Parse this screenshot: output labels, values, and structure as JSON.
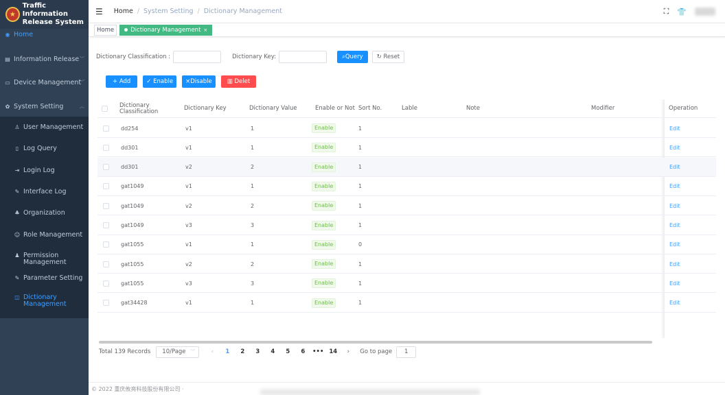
{
  "app": {
    "title_line1": "Traffic Information",
    "title_line2": "Release System"
  },
  "sidebar": {
    "items": [
      {
        "label": "Home",
        "icon": "dashboard-icon"
      },
      {
        "label": "Information Release",
        "icon": "message-icon"
      },
      {
        "label": "Device Management",
        "icon": "monitor-icon"
      },
      {
        "label": "System Setting",
        "icon": "gear-icon"
      }
    ],
    "subitems": [
      {
        "label": "User Management",
        "icon": "user-icon"
      },
      {
        "label": "Log Query",
        "icon": "log-icon"
      },
      {
        "label": "Login Log",
        "icon": "login-icon"
      },
      {
        "label": "Interface Log",
        "icon": "edit-icon"
      },
      {
        "label": "Organization",
        "icon": "tree-icon"
      },
      {
        "label": "Role Management",
        "icon": "people-icon"
      },
      {
        "label": "Permission Management",
        "icon": "peoples-icon"
      },
      {
        "label": "Parameter Setting",
        "icon": "tool-icon"
      },
      {
        "label": "Dictionary Management",
        "icon": "dict-icon"
      }
    ]
  },
  "header": {
    "breadcrumb": [
      "Home",
      "System Setting",
      "Dictionary Management"
    ]
  },
  "tags": {
    "home": "Home",
    "active": "Dictionary Management"
  },
  "filters": {
    "classification_label": "Dictionary Classification :",
    "classification_value": "",
    "key_label": "Dictionary Key:",
    "key_value": "",
    "query": "Query",
    "reset": "Reset"
  },
  "toolbar": {
    "add": "Add",
    "enable": "Enable",
    "disable": "Disable",
    "delete": "Delet"
  },
  "table": {
    "columns": [
      "Dictionary Classification",
      "Dictionary Key",
      "Dictionary Value",
      "Enable or Not",
      "Sort No.",
      "Lable",
      "Note",
      "Modifier",
      "Operation"
    ],
    "rows": [
      {
        "classification": "dd254",
        "key": "v1",
        "value": "1",
        "status": "Enable",
        "sort": "1",
        "action": "Edit"
      },
      {
        "classification": "dd301",
        "key": "v1",
        "value": "1",
        "status": "Enable",
        "sort": "1",
        "action": "Edit"
      },
      {
        "classification": "dd301",
        "key": "v2",
        "value": "2",
        "status": "Enable",
        "sort": "1",
        "action": "Edit"
      },
      {
        "classification": "gat1049",
        "key": "v1",
        "value": "1",
        "status": "Enable",
        "sort": "1",
        "action": "Edit"
      },
      {
        "classification": "gat1049",
        "key": "v2",
        "value": "2",
        "status": "Enable",
        "sort": "1",
        "action": "Edit"
      },
      {
        "classification": "gat1049",
        "key": "v3",
        "value": "3",
        "status": "Enable",
        "sort": "1",
        "action": "Edit"
      },
      {
        "classification": "gat1055",
        "key": "v1",
        "value": "1",
        "status": "Enable",
        "sort": "0",
        "action": "Edit"
      },
      {
        "classification": "gat1055",
        "key": "v2",
        "value": "2",
        "status": "Enable",
        "sort": "1",
        "action": "Edit"
      },
      {
        "classification": "gat1055",
        "key": "v3",
        "value": "3",
        "status": "Enable",
        "sort": "1",
        "action": "Edit"
      },
      {
        "classification": "gat34428",
        "key": "v1",
        "value": "1",
        "status": "Enable",
        "sort": "1",
        "action": "Edit"
      }
    ]
  },
  "pagination": {
    "total": "Total 139 Records",
    "page_size": "10/Page",
    "pages": [
      "1",
      "2",
      "3",
      "4",
      "5",
      "6",
      "•••",
      "14"
    ],
    "current": "1",
    "goto_label": "Go to page",
    "goto_value": "1"
  },
  "footer": {
    "text": "© 2022 重庆攸亮科技股份有限公司 ·"
  }
}
